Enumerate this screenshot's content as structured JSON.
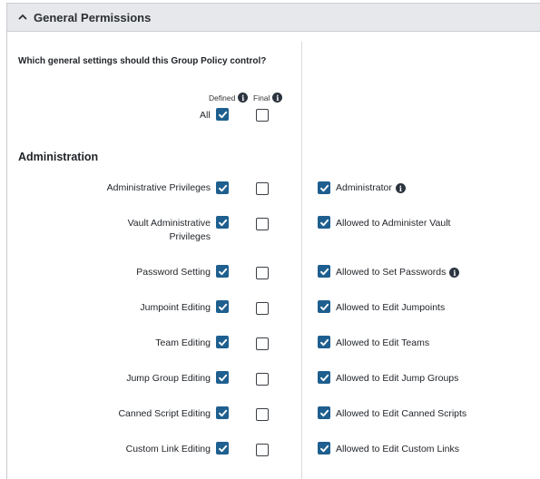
{
  "panel": {
    "title": "General Permissions"
  },
  "question": "Which general settings should this Group Policy control?",
  "columns": {
    "defined": "Defined",
    "final": "Final"
  },
  "all": {
    "label": "All",
    "defined": true,
    "final": false
  },
  "section_title": "Administration",
  "rows": [
    {
      "label": "Administrative Privileges",
      "defined": true,
      "final": false,
      "option": "Administrator",
      "option_checked": true,
      "option_info": true
    },
    {
      "label": "Vault Administrative Privileges",
      "defined": true,
      "final": false,
      "option": "Allowed to Administer Vault",
      "option_checked": true,
      "option_info": false
    },
    {
      "label": "Password Setting",
      "defined": true,
      "final": false,
      "option": "Allowed to Set Passwords",
      "option_checked": true,
      "option_info": true
    },
    {
      "label": "Jumpoint Editing",
      "defined": true,
      "final": false,
      "option": "Allowed to Edit Jumpoints",
      "option_checked": true,
      "option_info": false
    },
    {
      "label": "Team Editing",
      "defined": true,
      "final": false,
      "option": "Allowed to Edit Teams",
      "option_checked": true,
      "option_info": false
    },
    {
      "label": "Jump Group Editing",
      "defined": true,
      "final": false,
      "option": "Allowed to Edit Jump Groups",
      "option_checked": true,
      "option_info": false
    },
    {
      "label": "Canned Script Editing",
      "defined": true,
      "final": false,
      "option": "Allowed to Edit Canned Scripts",
      "option_checked": true,
      "option_info": false
    },
    {
      "label": "Custom Link Editing",
      "defined": true,
      "final": false,
      "option": "Allowed to Edit Custom Links",
      "option_checked": true,
      "option_info": false
    }
  ],
  "colors": {
    "accent": "#1e5f8f",
    "header_bg": "#e6e8eb",
    "border": "#c9ccd1"
  }
}
